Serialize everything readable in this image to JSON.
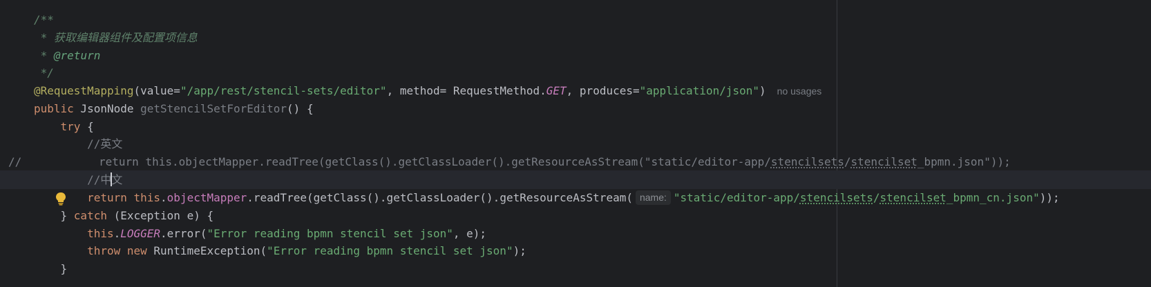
{
  "editor": {
    "colors": {
      "background": "#1e1f22",
      "current_line": "#26282e",
      "keyword": "#cf8e6d",
      "annotation": "#b3ae60",
      "string": "#6aab73",
      "doc_comment": "#5f826b",
      "comment": "#7a7e85",
      "field": "#c77dbb",
      "text": "#bcbec4"
    },
    "gutter": {
      "comment_marker": "//",
      "bulb_icon": "lightbulb-icon"
    },
    "lines": {
      "l1": {
        "t0": "/**"
      },
      "l2": {
        "t0": " * 获取编辑器组件及配置项信息"
      },
      "l3": {
        "t0": " * ",
        "t1": "@return"
      },
      "l4": {
        "t0": " */"
      },
      "l5": {
        "t0": "@RequestMapping",
        "t1": "(value=",
        "t2": "\"/app/rest/stencil-sets/editor\"",
        "t3": ", method= RequestMethod.",
        "t4": "GET",
        "t5": ", produces=",
        "t6": "\"application/json\"",
        "t7": ")",
        "hint": "no usages"
      },
      "l6": {
        "t0": "public",
        "t1": " JsonNode ",
        "t2": "getStencilSetForEditor",
        "t3": "() {"
      },
      "l7": {
        "t0": "    try",
        "t1": " {"
      },
      "l8": {
        "t0": "        //英文"
      },
      "l9": {
        "t0": "return this.objectMapper.readTree(getClass().getClassLoader().getResourceAsStream(\"static/editor-app/",
        "t1": "stencilsets",
        "t2": "/",
        "t3": "stencilset",
        "t4": "_bpmn.json\"));"
      },
      "l10": {
        "t0": "        //中",
        "t1": "文"
      },
      "l11": {
        "t0": "        return",
        "t1": " this",
        "t2": ".",
        "t3": "objectMapper",
        "t4": ".readTree(getClass().getClassLoader().getResourceAsStream(",
        "hint": "name:",
        "t5": "\"static/editor-app/",
        "t6": "stencilsets",
        "t7": "/",
        "t8": "stencilset",
        "t9": "_bpmn_cn.json\"",
        "t10": "));"
      },
      "l12": {
        "t0": "    } ",
        "t1": "catch",
        "t2": " (Exception e) {"
      },
      "l13": {
        "t0": "        this",
        "t1": ".",
        "t2": "LOGGER",
        "t3": ".error(",
        "t4": "\"Error reading bpmn stencil set json\"",
        "t5": ", e);"
      },
      "l14": {
        "t0": "        throw",
        "t1": " new",
        "t2": " RuntimeException(",
        "t3": "\"Error reading bpmn stencil set json\"",
        "t4": ");"
      },
      "l15": {
        "t0": "    }"
      }
    }
  }
}
